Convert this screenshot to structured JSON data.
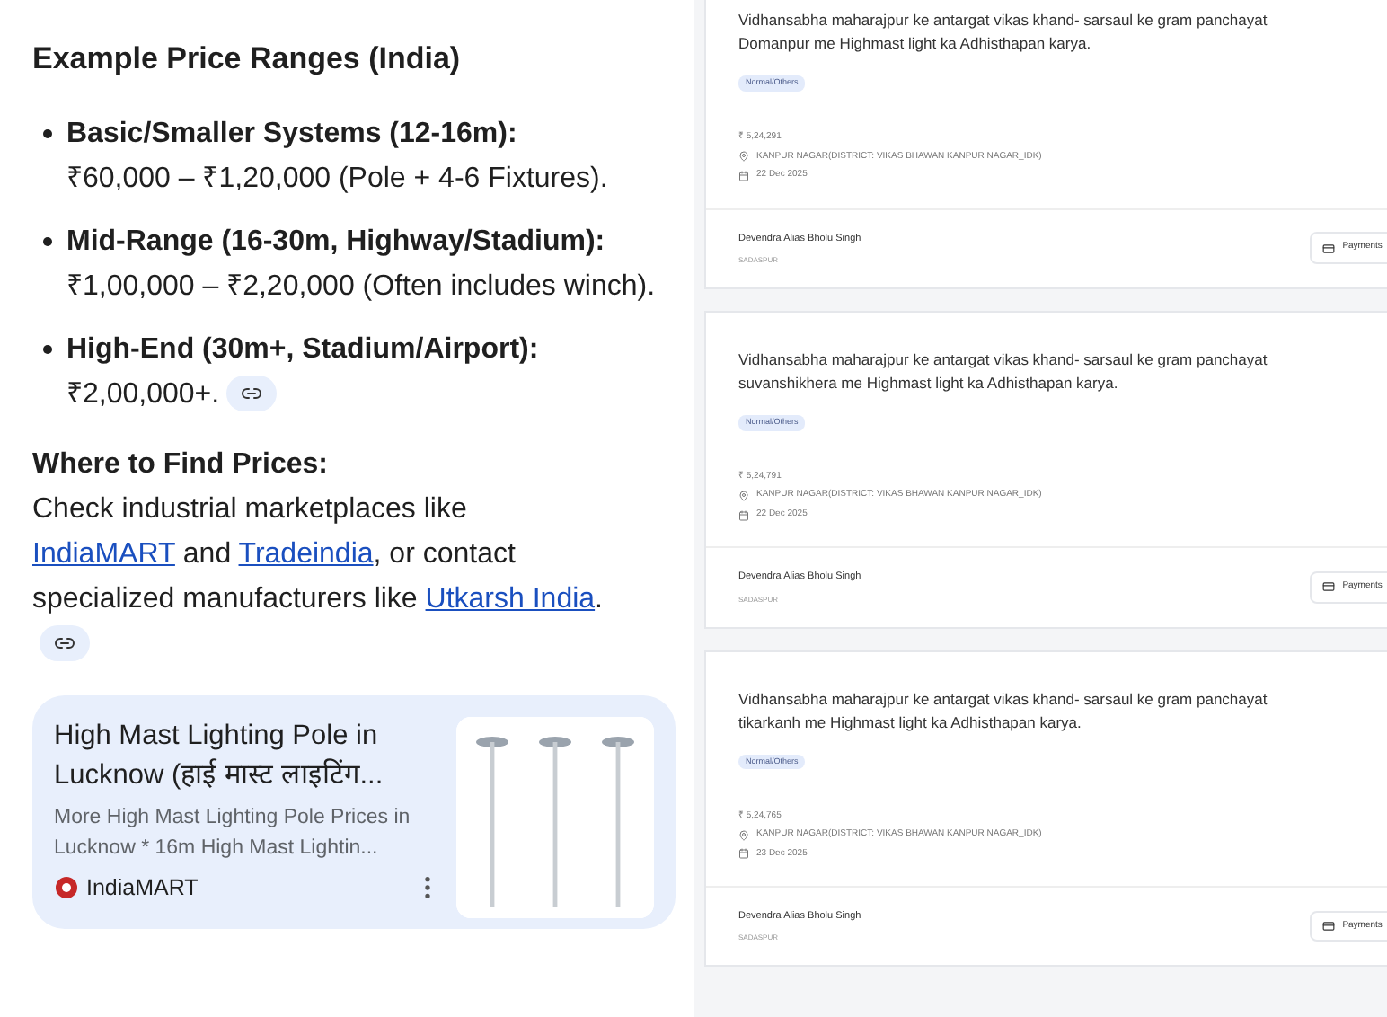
{
  "overview": {
    "heading": "Example Price Ranges (India)",
    "bullets": [
      {
        "label": "Basic/Smaller Systems (12-16m):",
        "text": "₹60,000 – ₹1,20,000 (Pole + 4-6 Fixtures).",
        "link_chip": false
      },
      {
        "label": "Mid-Range (16-30m, Highway/Stadium):",
        "text": "₹1,00,000 – ₹2,20,000 (Often includes winch).",
        "link_chip": false
      },
      {
        "label": "High-End (30m+, Stadium/Airport):",
        "text": "₹2,00,000+.",
        "link_chip": true
      }
    ],
    "subheading": "Where to Find Prices:",
    "paragraph": [
      {
        "kind": "text",
        "text": "Check industrial marketplaces like"
      },
      {
        "kind": "link",
        "text": "IndiaMART"
      },
      {
        "kind": "text",
        "text": "and"
      },
      {
        "kind": "link",
        "text": "Tradeindia"
      },
      {
        "kind": "text",
        "text": ", or contact specialized manufacturers like"
      },
      {
        "kind": "link",
        "text": "Utkarsh India"
      },
      {
        "kind": "text",
        "text": "."
      }
    ],
    "paragraph_link_chip": true,
    "source_card": {
      "title": "High Mast Lighting Pole in Lucknow (हाई मास्ट लाइटिंग...",
      "snippet": "More High Mast Lighting Pole Prices in Lucknow * 16m High Mast Lightin...",
      "source": "IndiaMART"
    }
  },
  "tenders": [
    {
      "title": "Vidhansabha maharajpur ke antargat vikas khand- sarsaul ke gram panchayat Domanpur me Highmast light ka Adhisthapan karya.",
      "tag": "Normal/Others",
      "amount": "₹ 5,24,291",
      "location": "KANPUR NAGAR(DISTRICT: VIKAS BHAWAN KANPUR NAGAR_IDK)",
      "date": "22 Dec 2025",
      "officer": "Devendra Alias Bholu Singh",
      "office": "SADASPUR",
      "button": "Payments"
    },
    {
      "title": "Vidhansabha maharajpur ke antargat vikas khand- sarsaul ke gram panchayat suvanshikhera me Highmast light ka Adhisthapan karya.",
      "tag": "Normal/Others",
      "amount": "₹ 5,24,791",
      "location": "KANPUR NAGAR(DISTRICT: VIKAS BHAWAN KANPUR NAGAR_IDK)",
      "date": "22 Dec 2025",
      "officer": "Devendra Alias Bholu Singh",
      "office": "SADASPUR",
      "button": "Payments"
    },
    {
      "title": "Vidhansabha maharajpur ke antargat vikas khand- sarsaul ke gram panchayat tikarkanh me Highmast light ka Adhisthapan karya.",
      "tag": "Normal/Others",
      "amount": "₹ 5,24,765",
      "location": "KANPUR NAGAR(DISTRICT: VIKAS BHAWAN KANPUR NAGAR_IDK)",
      "date": "23 Dec 2025",
      "officer": "Devendra Alias Bholu Singh",
      "office": "SADASPUR",
      "button": "Payments"
    }
  ]
}
